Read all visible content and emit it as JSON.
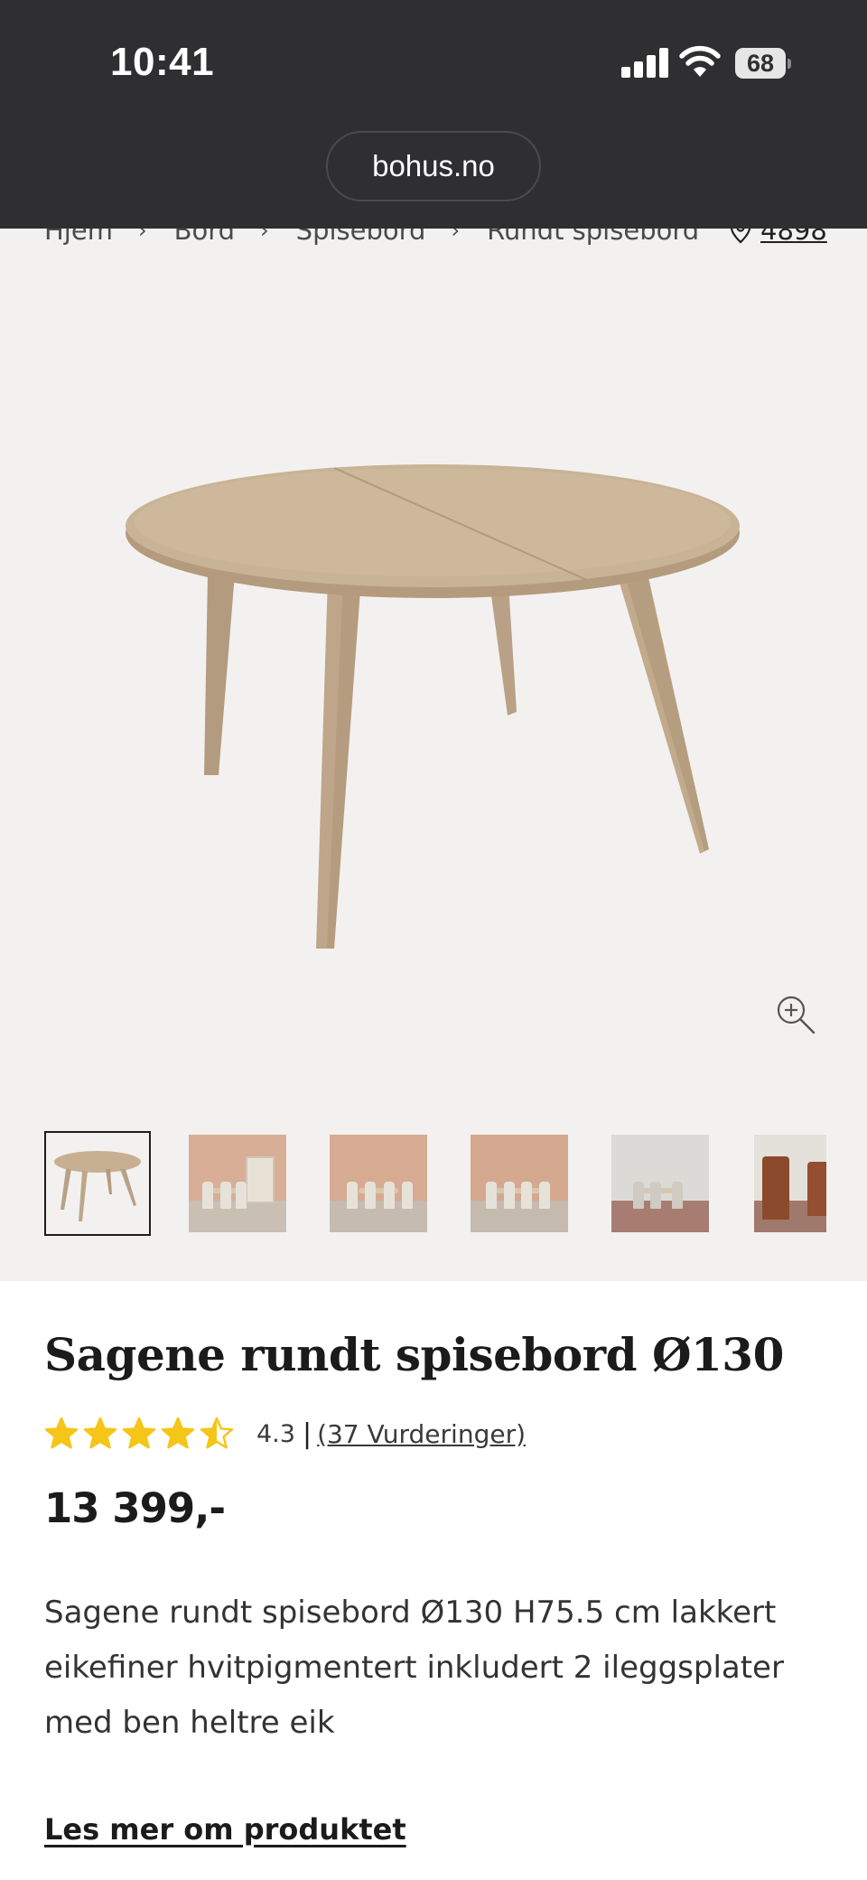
{
  "status_bar": {
    "time": "10:41",
    "battery": "68"
  },
  "browser": {
    "url": "bohus.no"
  },
  "breadcrumb": {
    "items": [
      "Hjem",
      "Bord",
      "Spisebord",
      "Rundt spisebord"
    ],
    "store": "4898"
  },
  "gallery": {
    "thumbnail_count": 6,
    "selected_index": 0
  },
  "product": {
    "title": "Sagene rundt spisebord Ø130",
    "rating_value": "4.3",
    "rating_separator": "|",
    "reviews_label": "(37 Vurderinger)",
    "rating_stars": 4.3,
    "price": "13 399,-",
    "description": "Sagene rundt spisebord Ø130 H75.5 cm lakkert eikefiner hvitpigmentert inkludert 2 ileggsplater med ben heltre eik",
    "read_more": "Les mer om produktet"
  },
  "colors": {
    "topbar": "#2f2f31",
    "gallery_bg": "#f3f1ef",
    "star": "#f5c518",
    "text": "#1b1b1b"
  }
}
